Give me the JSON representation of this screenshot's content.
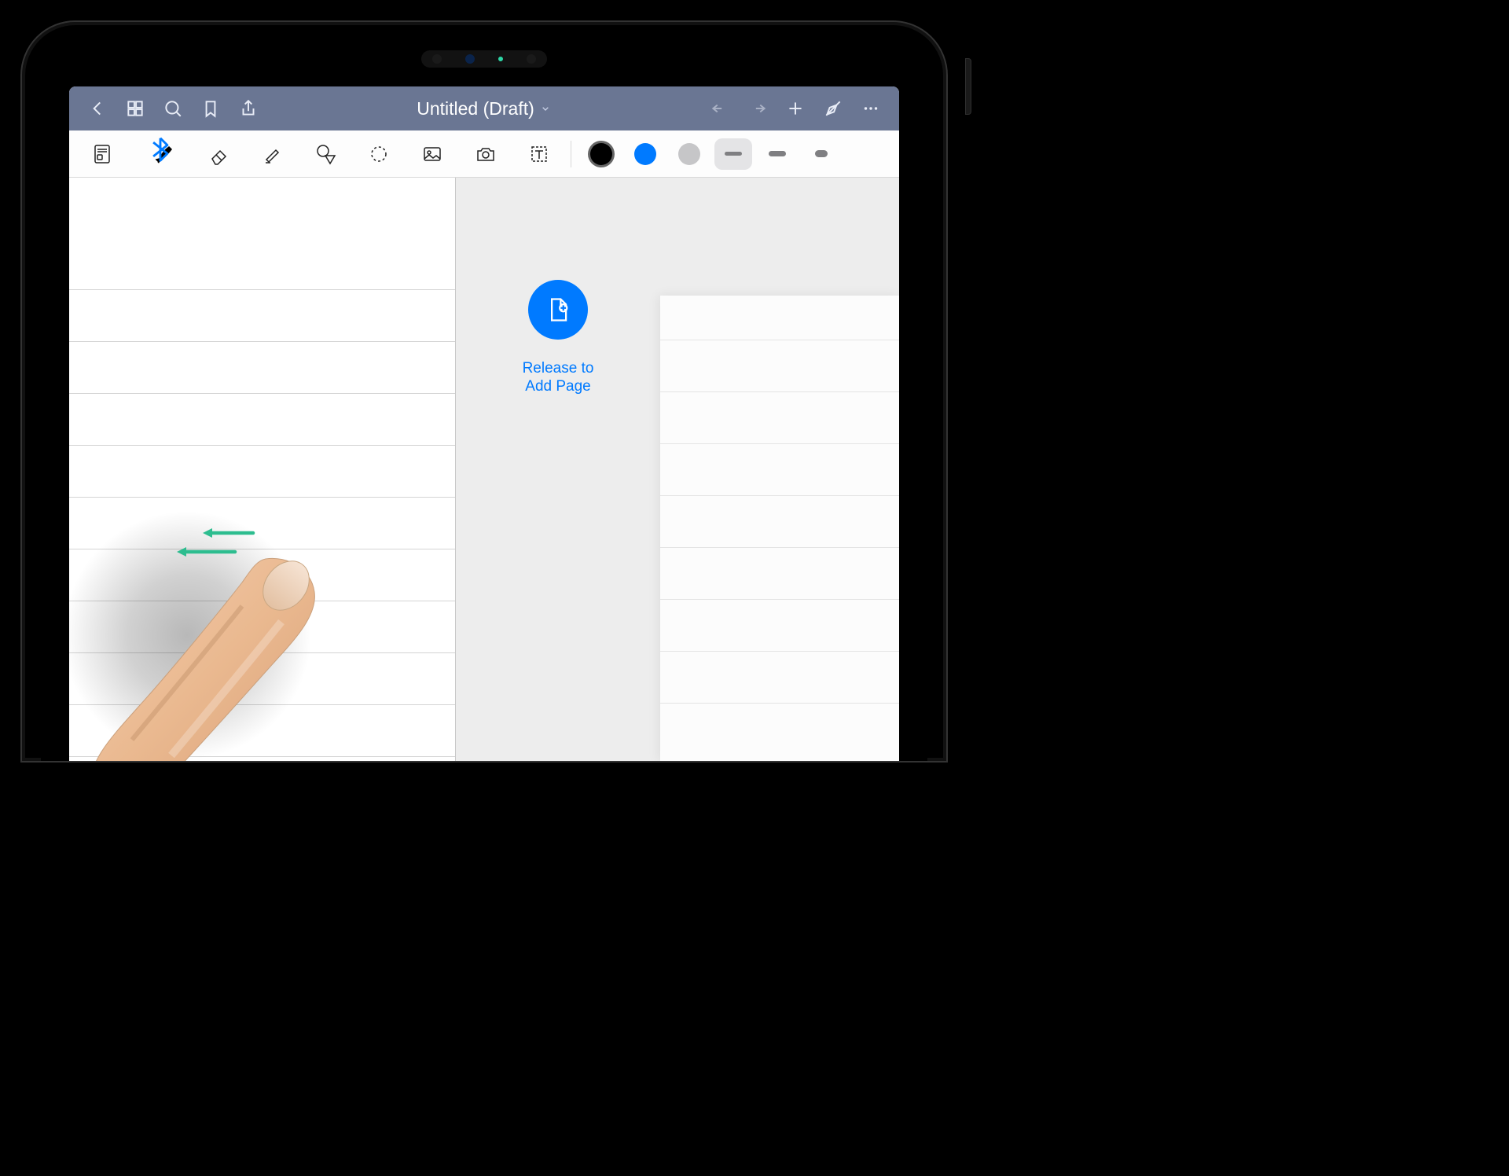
{
  "header": {
    "title": "Untitled (Draft)",
    "icons": {
      "back": "back-chevron-icon",
      "grid": "grid-icon",
      "search": "search-icon",
      "bookmark": "bookmark-icon",
      "share": "share-icon",
      "undo": "undo-icon",
      "redo": "redo-icon",
      "add": "plus-icon",
      "stylus": "stylus-off-icon",
      "more": "more-icon"
    }
  },
  "toolbar": {
    "tools": [
      {
        "name": "page-template-tool",
        "active": false
      },
      {
        "name": "pen-tool",
        "active": true,
        "badge": "bluetooth"
      },
      {
        "name": "eraser-tool",
        "active": false
      },
      {
        "name": "highlighter-tool",
        "active": false
      },
      {
        "name": "shape-tool",
        "active": false
      },
      {
        "name": "lasso-tool",
        "active": false
      },
      {
        "name": "image-tool",
        "active": false
      },
      {
        "name": "camera-tool",
        "active": false
      },
      {
        "name": "text-tool",
        "active": false
      }
    ],
    "colors": [
      {
        "hex": "#000000",
        "selected": true
      },
      {
        "hex": "#007aff",
        "selected": false
      },
      {
        "hex": "#c6c6c8",
        "selected": false
      }
    ],
    "thickness": [
      {
        "name": "thin",
        "selected": true
      },
      {
        "name": "medium",
        "selected": false
      },
      {
        "name": "thick",
        "selected": false
      }
    ]
  },
  "canvas": {
    "add_page_label": "Release to\nAdd Page"
  }
}
